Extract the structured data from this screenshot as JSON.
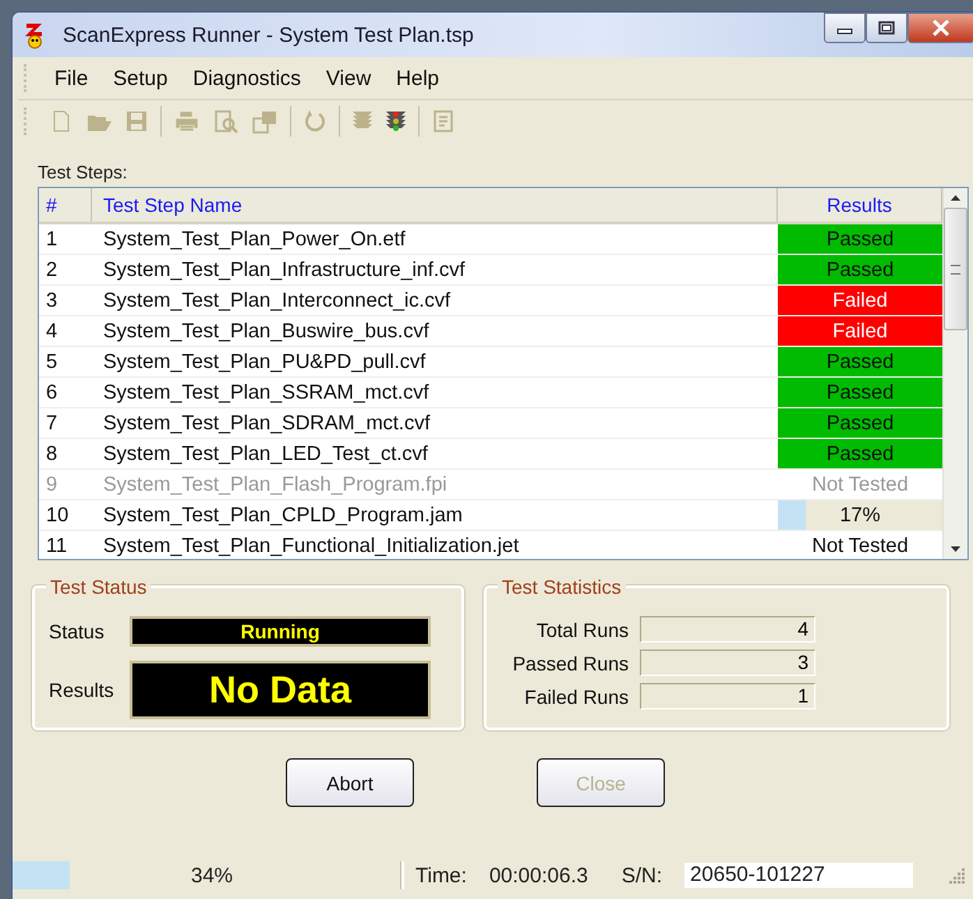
{
  "window": {
    "title": "ScanExpress Runner - System Test Plan.tsp"
  },
  "menu": [
    "File",
    "Setup",
    "Diagnostics",
    "View",
    "Help"
  ],
  "toolbar": [
    {
      "kind": "new",
      "disabled": true
    },
    {
      "kind": "open",
      "disabled": true
    },
    {
      "kind": "save",
      "disabled": true
    },
    {
      "kind": "sep"
    },
    {
      "kind": "print",
      "disabled": true
    },
    {
      "kind": "preview",
      "disabled": true
    },
    {
      "kind": "setup",
      "disabled": true
    },
    {
      "kind": "sep"
    },
    {
      "kind": "refresh",
      "disabled": true
    },
    {
      "kind": "sep"
    },
    {
      "kind": "light",
      "disabled": true
    },
    {
      "kind": "light",
      "disabled": false
    },
    {
      "kind": "sep"
    },
    {
      "kind": "report",
      "disabled": true
    }
  ],
  "steps": {
    "label": "Test Steps:",
    "columns": [
      "#",
      "Test Step Name",
      "Results"
    ],
    "rows": [
      {
        "num": "1",
        "name": "System_Test_Plan_Power_On.etf",
        "disabled": false,
        "result": {
          "kind": "passed",
          "text": "Passed"
        }
      },
      {
        "num": "2",
        "name": "System_Test_Plan_Infrastructure_inf.cvf",
        "disabled": false,
        "result": {
          "kind": "passed",
          "text": "Passed"
        }
      },
      {
        "num": "3",
        "name": "System_Test_Plan_Interconnect_ic.cvf",
        "disabled": false,
        "result": {
          "kind": "failed",
          "text": "Failed"
        }
      },
      {
        "num": "4",
        "name": "System_Test_Plan_Buswire_bus.cvf",
        "disabled": false,
        "result": {
          "kind": "failed",
          "text": "Failed"
        }
      },
      {
        "num": "5",
        "name": "System_Test_Plan_PU&PD_pull.cvf",
        "disabled": false,
        "result": {
          "kind": "passed",
          "text": "Passed"
        }
      },
      {
        "num": "6",
        "name": "System_Test_Plan_SSRAM_mct.cvf",
        "disabled": false,
        "result": {
          "kind": "passed",
          "text": "Passed"
        }
      },
      {
        "num": "7",
        "name": "System_Test_Plan_SDRAM_mct.cvf",
        "disabled": false,
        "result": {
          "kind": "passed",
          "text": "Passed"
        }
      },
      {
        "num": "8",
        "name": "System_Test_Plan_LED_Test_ct.cvf",
        "disabled": false,
        "result": {
          "kind": "passed",
          "text": "Passed"
        }
      },
      {
        "num": "9",
        "name": "System_Test_Plan_Flash_Program.fpi",
        "disabled": true,
        "result": {
          "kind": "pending",
          "text": "Not Tested"
        }
      },
      {
        "num": "10",
        "name": "System_Test_Plan_CPLD_Program.jam",
        "disabled": false,
        "result": {
          "kind": "progress",
          "text": "17%",
          "level": 0.17
        }
      },
      {
        "num": "11",
        "name": "System_Test_Plan_Functional_Initialization.jet",
        "disabled": false,
        "result": {
          "kind": "pending",
          "text": "Not Tested"
        }
      }
    ]
  },
  "test_status": {
    "title": "Test Status",
    "status_label": "Status",
    "status": "Running",
    "results_label": "Results",
    "results": "No Data"
  },
  "test_statistics": {
    "title": "Test Statistics",
    "rows": [
      {
        "label": "Total Runs",
        "value": "4"
      },
      {
        "label": "Passed Runs",
        "value": "3"
      },
      {
        "label": "Failed Runs",
        "value": "1"
      }
    ]
  },
  "buttons": [
    {
      "label": "Abort",
      "disabled": false
    },
    {
      "label": "Close",
      "disabled": true
    }
  ],
  "status_bar": {
    "progress": {
      "level": 0.34,
      "text": "34%"
    },
    "time_label": "Time:",
    "time": "00:00:06.3",
    "sn_label": "S/N:",
    "sn": "20650-101227"
  }
}
